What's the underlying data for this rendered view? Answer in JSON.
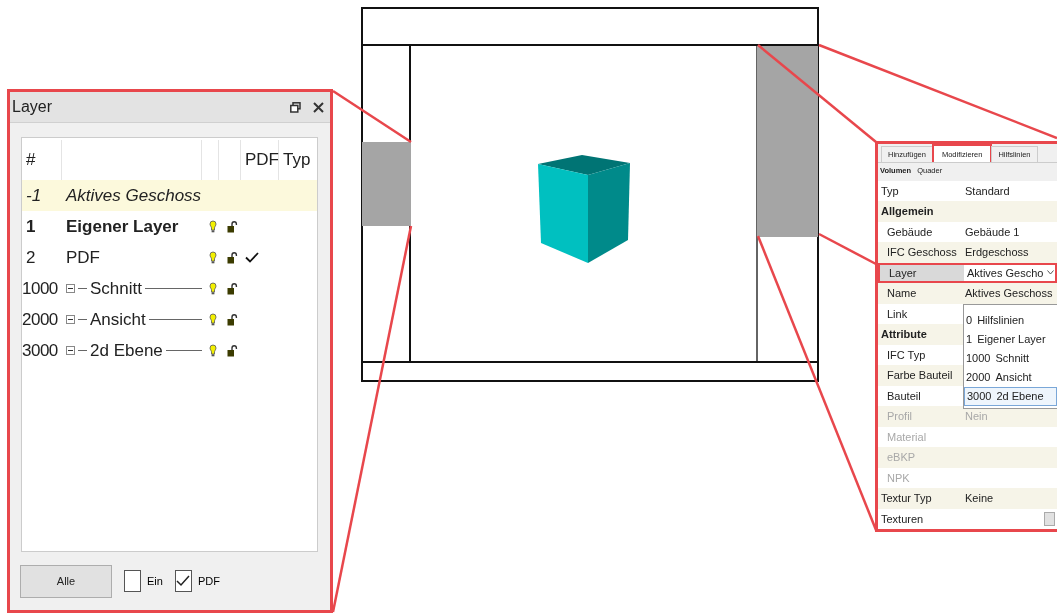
{
  "layer_panel": {
    "title": "Layer",
    "columns": [
      "#",
      "PDF",
      "Typ"
    ],
    "rows": [
      {
        "number": "-1",
        "name": "Aktives Geschoss",
        "kind": "floor",
        "selected": true,
        "current": false,
        "pdf": false
      },
      {
        "number": "1",
        "name": "Eigener Layer",
        "kind": "layer",
        "selected": false,
        "current": true,
        "pdf": false
      },
      {
        "number": "2",
        "name": "PDF",
        "kind": "layer",
        "selected": false,
        "current": false,
        "pdf": true
      },
      {
        "number": "1000",
        "name": "Schnitt",
        "kind": "group",
        "selected": false,
        "current": false,
        "pdf": false
      },
      {
        "number": "2000",
        "name": "Ansicht",
        "kind": "group",
        "selected": false,
        "current": false,
        "pdf": false
      },
      {
        "number": "3000",
        "name": "2d Ebene",
        "kind": "group",
        "selected": false,
        "current": false,
        "pdf": false
      }
    ],
    "button": "Alle",
    "checkboxes": [
      {
        "label": "Ein",
        "checked": false
      },
      {
        "label": "PDF",
        "checked": true
      }
    ]
  },
  "properties_panel": {
    "tabs": [
      {
        "label": "Hinzufügen",
        "selected": false
      },
      {
        "label": "Modifizieren",
        "selected": true
      },
      {
        "label": "Hilfslinien",
        "selected": false
      }
    ],
    "breadcrumb": [
      "Volumen",
      "Quader"
    ],
    "properties": [
      {
        "kind": "property",
        "label": "Typ",
        "value": "Standard"
      },
      {
        "kind": "section",
        "label": "Allgemein",
        "children": [
          {
            "kind": "property",
            "label": "Gebäude",
            "value": "Gebäude 1"
          },
          {
            "kind": "property",
            "label": "IFC Geschoss",
            "value": "Erdgeschoss"
          },
          {
            "kind": "combo",
            "label": "Layer",
            "value": "Aktives Gescho",
            "selected": true
          },
          {
            "kind": "property",
            "label": "Name",
            "value": "Aktives Geschoss"
          },
          {
            "kind": "property",
            "label": "Link"
          }
        ]
      },
      {
        "kind": "section",
        "label": "Attribute",
        "children": [
          {
            "kind": "property",
            "label": "IFC Typ"
          },
          {
            "kind": "property",
            "label": "Farbe Bauteil"
          },
          {
            "kind": "property",
            "label": "Bauteil"
          },
          {
            "kind": "property",
            "label": "Profil",
            "value": "Nein",
            "disabled": true
          },
          {
            "kind": "property",
            "label": "Material",
            "disabled": true
          },
          {
            "kind": "property",
            "label": "eBKP",
            "disabled": true
          },
          {
            "kind": "property",
            "label": "NPK",
            "disabled": true
          }
        ]
      },
      {
        "kind": "property",
        "label": "Textur Typ",
        "value": "Keine"
      },
      {
        "kind": "button",
        "label": "Texturen"
      }
    ],
    "dropdown": [
      {
        "number": "0",
        "name": "Hilfslinien",
        "selected": false
      },
      {
        "number": "1",
        "name": "Eigener Layer",
        "selected": false
      },
      {
        "number": "1000",
        "name": "Schnitt",
        "selected": false
      },
      {
        "number": "2000",
        "name": "Ansicht",
        "selected": false
      },
      {
        "number": "3000",
        "name": "2d Ebene",
        "selected": true
      }
    ]
  }
}
